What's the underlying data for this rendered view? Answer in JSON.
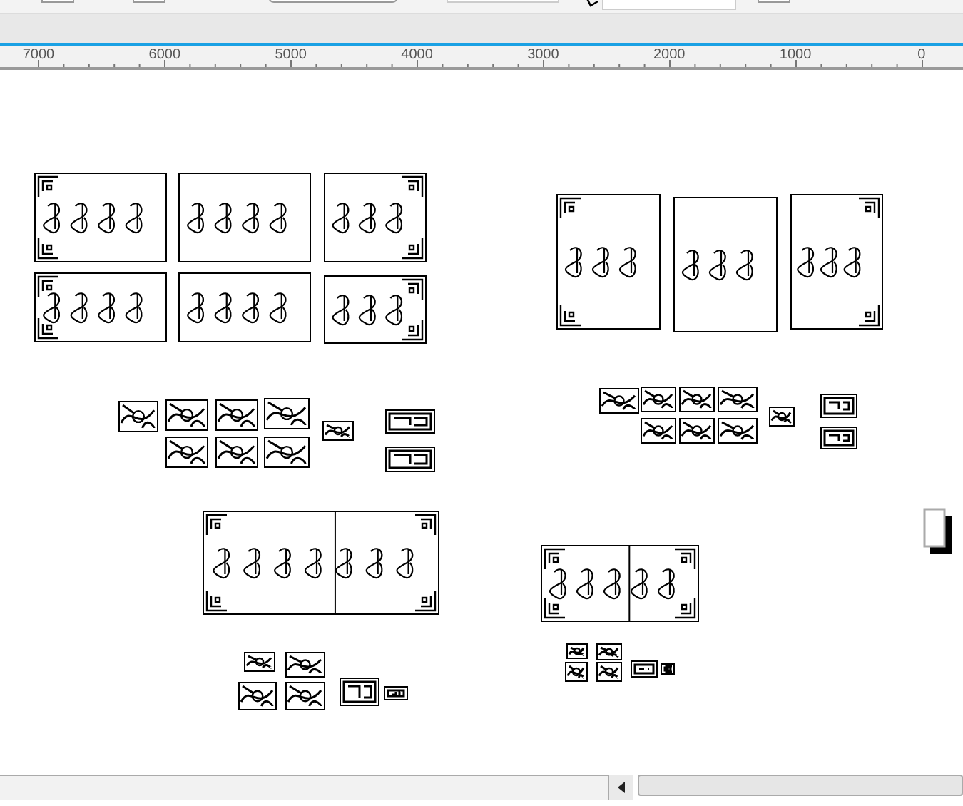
{
  "ruler": {
    "labels": [
      "7000",
      "6000",
      "5000",
      "4000",
      "3000",
      "2000",
      "1000",
      "0"
    ]
  }
}
